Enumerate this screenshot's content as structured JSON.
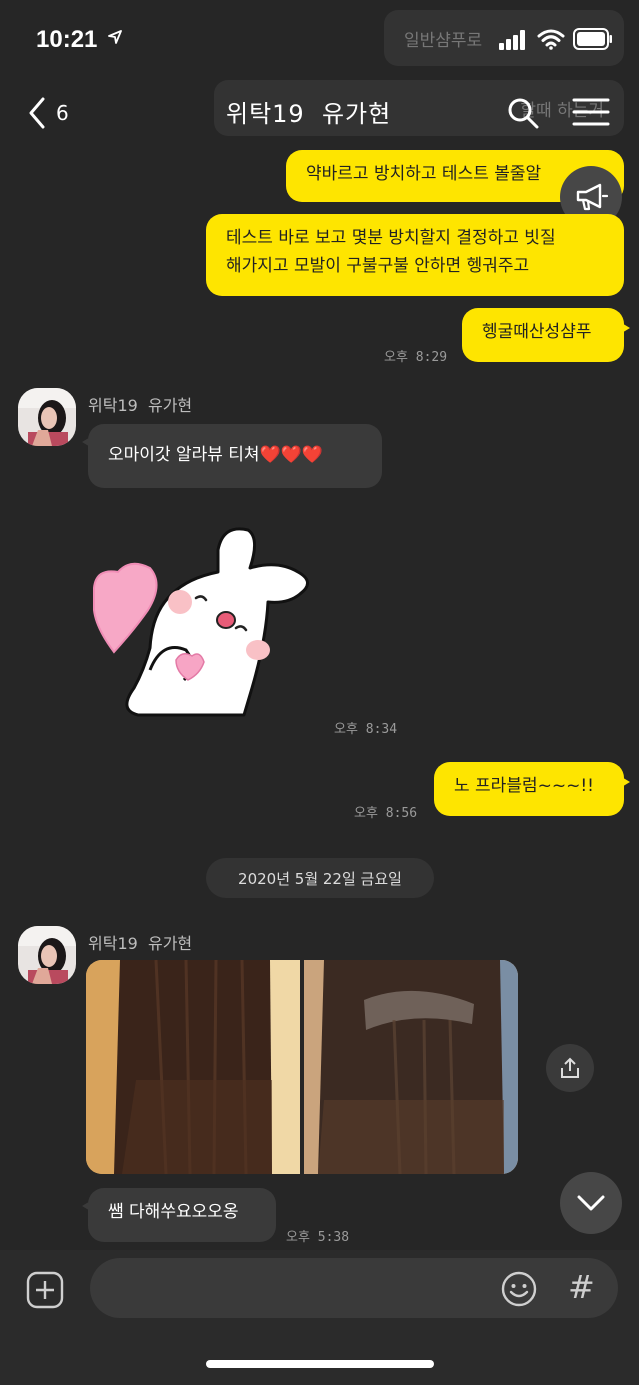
{
  "status_bar": {
    "time": "10:21",
    "ghost_preview_1": "일반샴푸로",
    "ghost_preview_2": "할때 하는거"
  },
  "header": {
    "back_count": "6",
    "title": "위탁19  유가현"
  },
  "messages": [
    {
      "from": "me",
      "text": "약바르고 방치하고 테스트 볼줄알"
    },
    {
      "from": "me",
      "text_line1": "테스트 바로 보고 몇분 방치할지 결정하고 빗질",
      "text_line2": "해가지고 모발이 구불구불 안하면 헹궈주고"
    },
    {
      "from": "me",
      "text": "헹굴때산성샴푸",
      "time": "오후 8:29"
    },
    {
      "from": "them",
      "sender": "위탁19  유가현",
      "text": "오마이갓 알라뷰 티쳐❤️❤️❤️"
    },
    {
      "from": "them",
      "type": "sticker",
      "time": "오후 8:34"
    },
    {
      "from": "me",
      "text": "노 프라블럼~~~!!",
      "time": "오후 8:56"
    },
    {
      "type": "date",
      "text": "2020년 5월 22일 금요일"
    },
    {
      "from": "them",
      "sender": "위탁19  유가현",
      "type": "photos"
    },
    {
      "from": "them",
      "text": "쌤 다해쑤요오오옹",
      "time": "오후 5:38"
    }
  ],
  "input": {
    "placeholder": ""
  },
  "colors": {
    "background": "#262626",
    "my_bubble": "#fee500",
    "their_bubble": "#3a3a3a"
  },
  "icons": [
    "location-arrow-icon",
    "signal-icon",
    "wifi-icon",
    "battery-icon",
    "back-chevron-icon",
    "search-icon",
    "menu-icon",
    "megaphone-icon",
    "share-icon",
    "chevron-down-icon",
    "plus-icon",
    "emoji-icon",
    "hash-icon"
  ]
}
